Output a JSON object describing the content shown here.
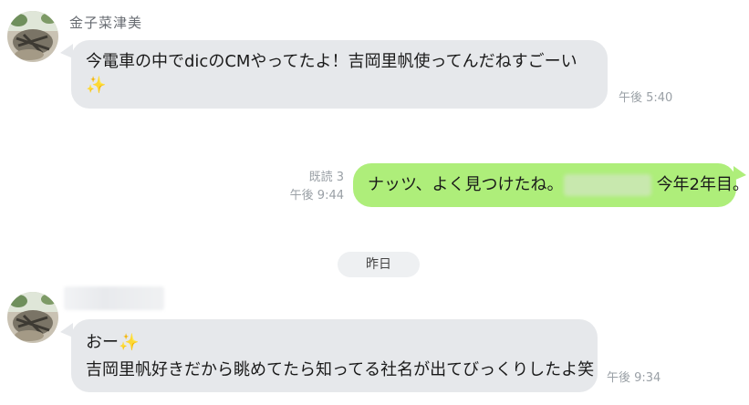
{
  "messages": [
    {
      "sender": "金子菜津美",
      "text_line1": "今電車の中でdicのCMやってたよ！吉岡里帆使ってんだねすごーい",
      "text_line2": "✨",
      "time": "午後 5:40"
    },
    {
      "read_label": "既読 3",
      "text_before": "ナッツ、よく見つけたね。",
      "text_after": "今年2年目。",
      "time": "午後 9:44"
    },
    {
      "sender": "",
      "text_line1": "おー✨",
      "text_line2": "吉岡里帆好きだから眺めてたら知ってる社名が出てびっくりしたよ笑",
      "time": "午後 9:34"
    }
  ],
  "date_separator": "昨日",
  "colors": {
    "incoming_bubble": "#e6e8eb",
    "outgoing_bubble": "#aeee7a",
    "meta_text": "#9aa0a6"
  }
}
